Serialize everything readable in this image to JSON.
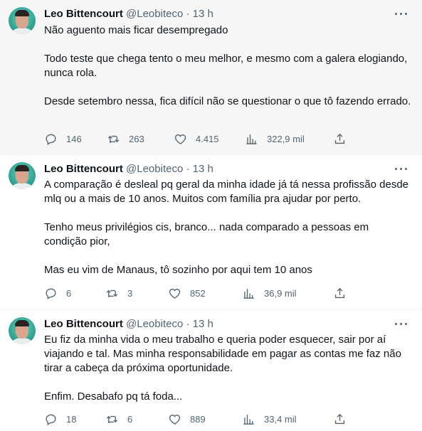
{
  "author": {
    "name": "Leo Bittencourt",
    "handle": "@Leobiteco",
    "separator": "·"
  },
  "tweets": [
    {
      "time": "13 h",
      "paragraphs": [
        "Não aguento mais ficar desempregado",
        "Todo teste que chega tento o meu melhor, e mesmo com a galera elogiando, nunca rola.",
        "Desde setembro nessa, fica difícil não se questionar o que tô fazendo errado."
      ],
      "replies": "146",
      "retweets": "263",
      "likes": "4.415",
      "views": "322,9 mil"
    },
    {
      "time": "13 h",
      "paragraphs": [
        "A comparação é desleal pq geral da minha idade já tá nessa profissão desde mlq ou a mais de 10 anos. Muitos com família pra ajudar por perto.",
        "Tenho meus privilégios cis, branco... nada comparado a pessoas em condição pior,",
        "Mas eu vim de Manaus, tô sozinho por aqui tem 10 anos"
      ],
      "replies": "6",
      "retweets": "3",
      "likes": "852",
      "views": "36,9 mil"
    },
    {
      "time": "13 h",
      "paragraphs": [
        "Eu fiz da minha vida o meu trabalho e queria poder esquecer, sair por aí viajando e tal. Mas minha responsabilidade em pagar as contas me faz não tirar a cabeça da próxima oportunidade.",
        "Enfim. Desabafo pq tá foda..."
      ],
      "replies": "18",
      "retweets": "6",
      "likes": "889",
      "views": "33,4 mil"
    }
  ],
  "icons": {
    "reply": "reply-icon",
    "retweet": "retweet-icon",
    "like": "like-icon",
    "views": "views-icon",
    "share": "share-icon",
    "more": "more-icon"
  },
  "colors": {
    "text": "#0f1419",
    "muted": "#536471",
    "highlight_bg": "#f7f7f7"
  }
}
